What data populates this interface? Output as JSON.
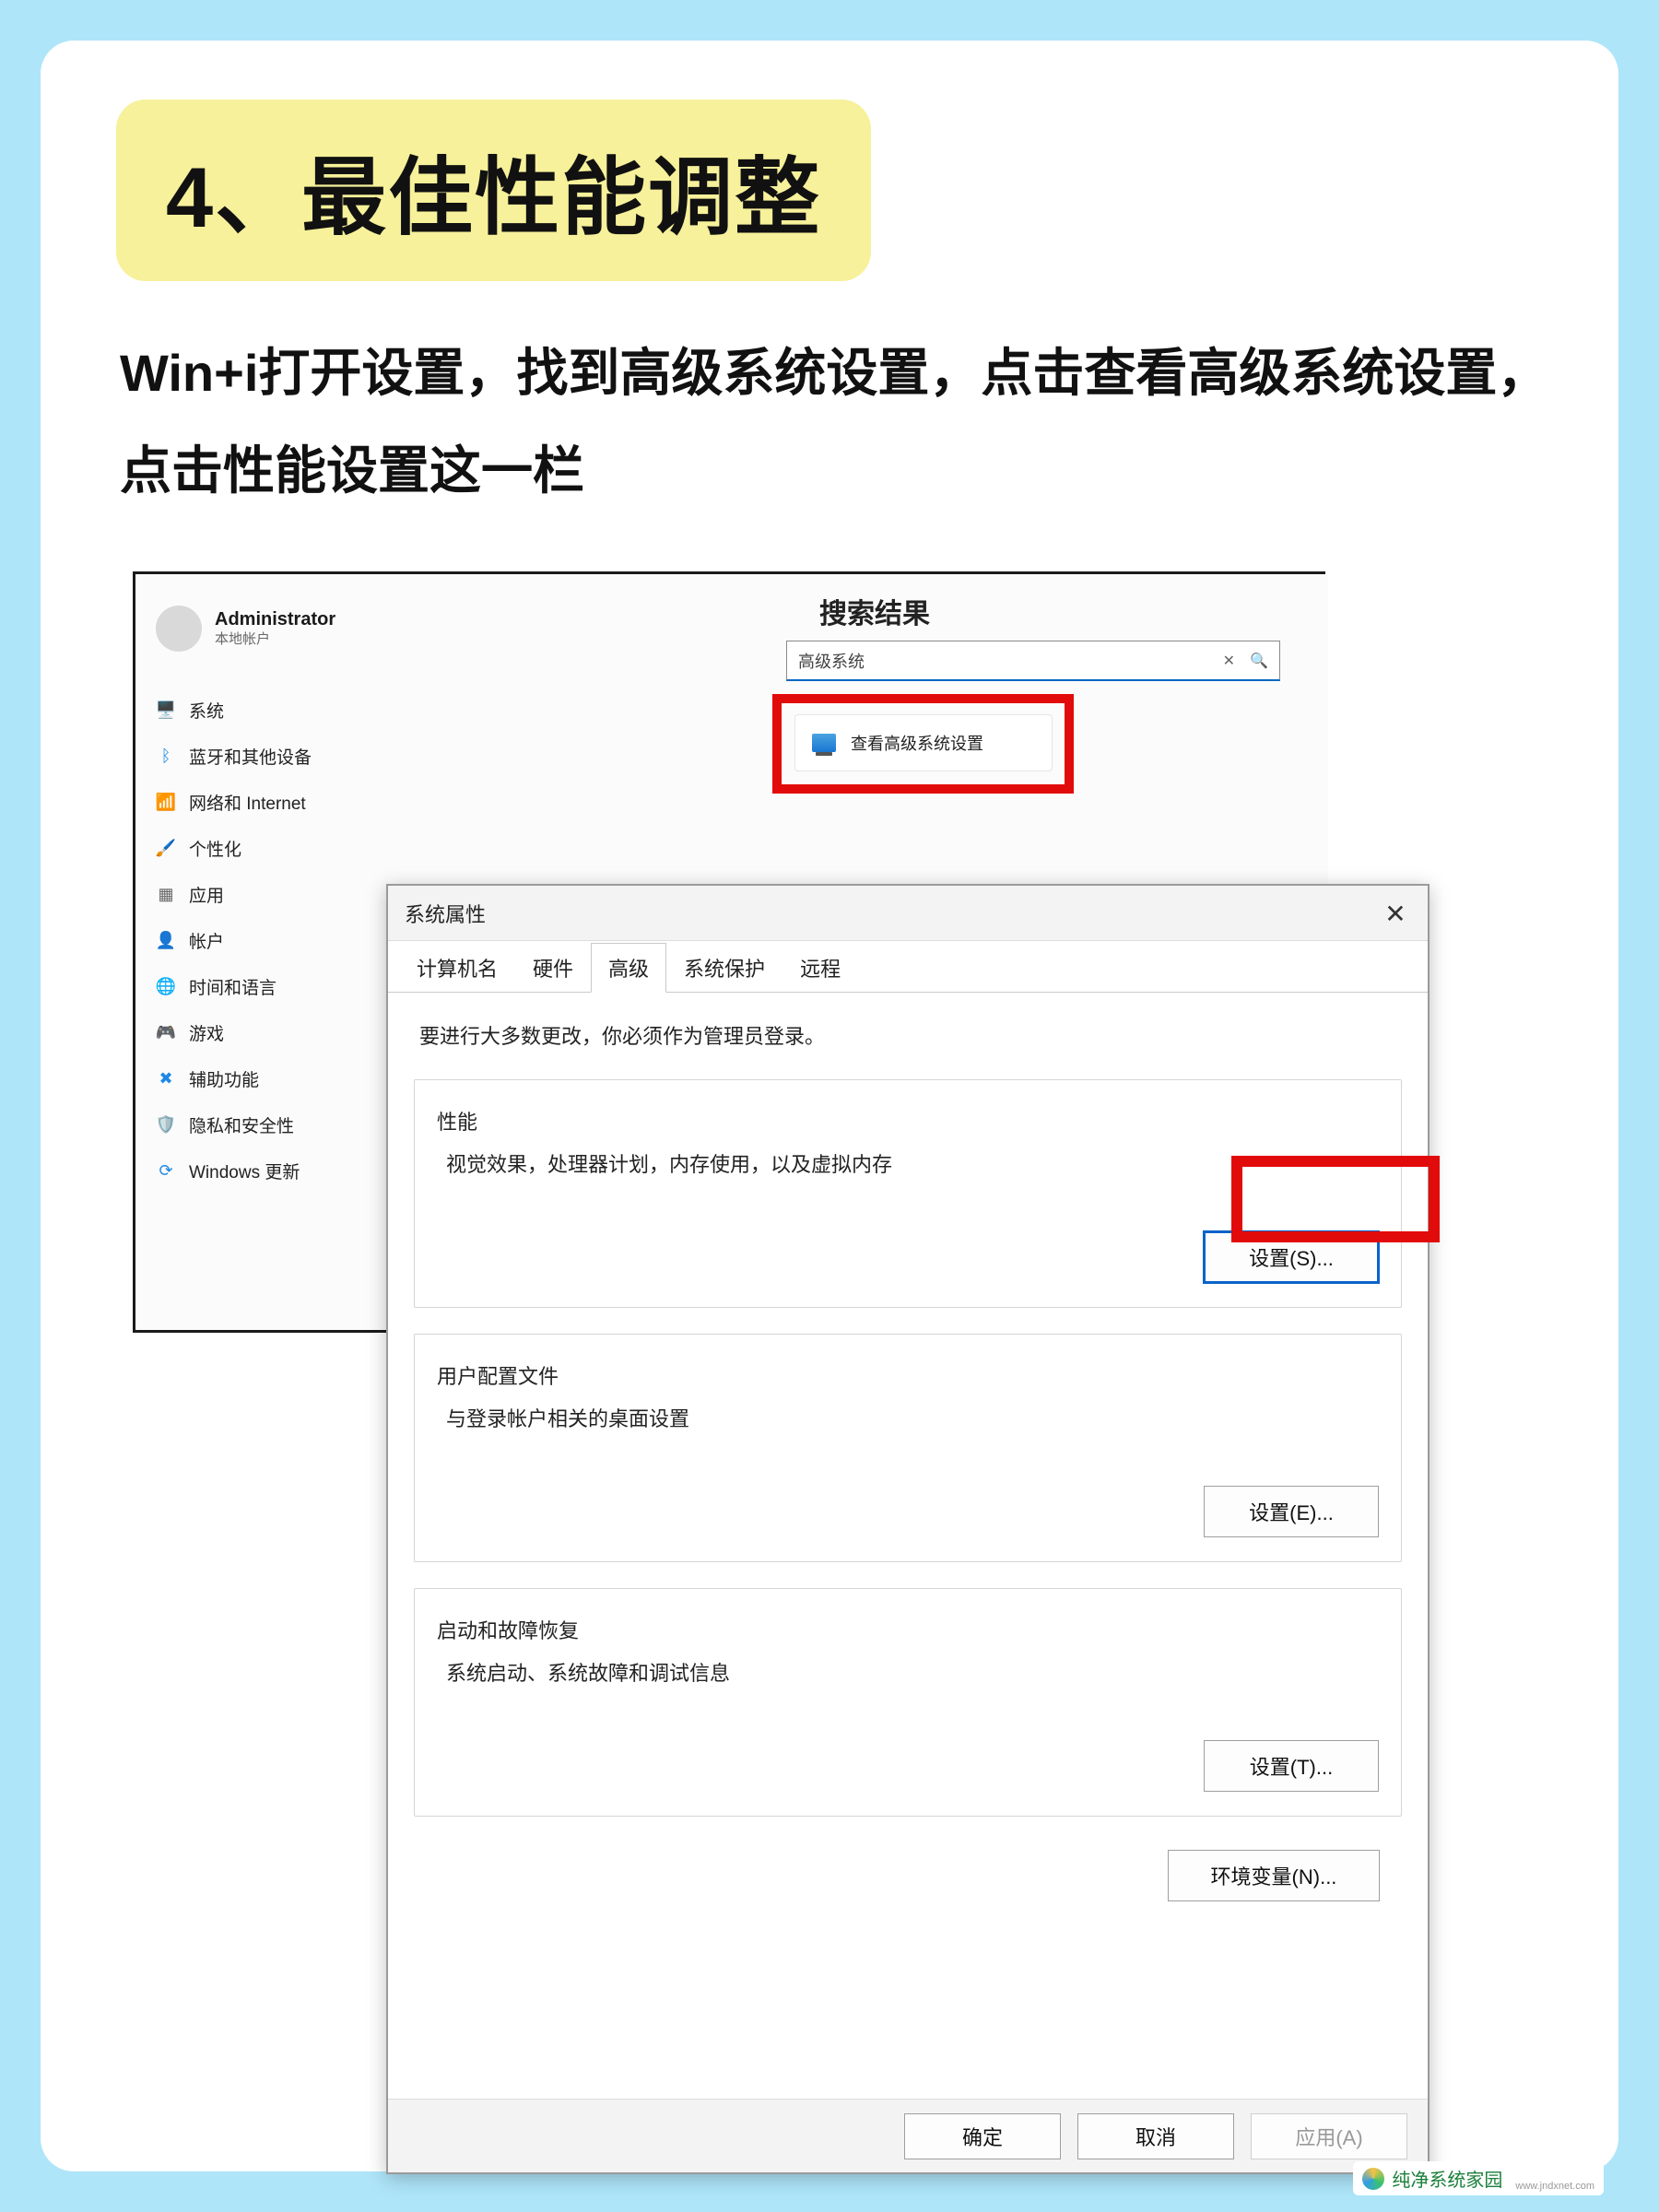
{
  "banner": {
    "title": "4、最佳性能调整"
  },
  "instructions": "Win+i打开设置，找到高级系统设置，点击查看高级系统设置，点击性能设置这一栏",
  "settings": {
    "user": {
      "name": "Administrator",
      "subtitle": "本地帐户"
    },
    "nav": [
      {
        "icon": "🖥️",
        "label": "系统",
        "color": "#1e88e5"
      },
      {
        "icon": "ᛒ",
        "label": "蓝牙和其他设备",
        "color": "#1e88e5"
      },
      {
        "icon": "📶",
        "label": "网络和 Internet",
        "color": "#1e88e5"
      },
      {
        "icon": "🖌️",
        "label": "个性化",
        "color": "#c09030"
      },
      {
        "icon": "▦",
        "label": "应用",
        "color": "#666"
      },
      {
        "icon": "👤",
        "label": "帐户",
        "color": "#2e9e5b"
      },
      {
        "icon": "🌐",
        "label": "时间和语言",
        "color": "#3a6fb0"
      },
      {
        "icon": "🎮",
        "label": "游戏",
        "color": "#888"
      },
      {
        "icon": "✖",
        "label": "辅助功能",
        "color": "#1e88e5"
      },
      {
        "icon": "🛡️",
        "label": "隐私和安全性",
        "color": "#888"
      },
      {
        "icon": "⟳",
        "label": "Windows 更新",
        "color": "#1e88e5"
      }
    ],
    "main": {
      "heading": "搜索结果",
      "search_value": "高级系统",
      "result_label": "查看高级系统设置"
    }
  },
  "sysprop": {
    "title": "系统属性",
    "tabs": [
      "计算机名",
      "硬件",
      "高级",
      "系统保护",
      "远程"
    ],
    "active_tab_index": 2,
    "note": "要进行大多数更改，你必须作为管理员登录。",
    "groups": {
      "performance": {
        "title": "性能",
        "desc": "视觉效果，处理器计划，内存使用，以及虚拟内存",
        "button": "设置(S)..."
      },
      "profiles": {
        "title": "用户配置文件",
        "desc": "与登录帐户相关的桌面设置",
        "button": "设置(E)..."
      },
      "startup": {
        "title": "启动和故障恢复",
        "desc": "系统启动、系统故障和调试信息",
        "button": "设置(T)..."
      }
    },
    "env_button": "环境变量(N)...",
    "footer": {
      "ok": "确定",
      "cancel": "取消",
      "apply": "应用(A)"
    }
  },
  "watermark": {
    "text": "纯净系统家园",
    "sub": "www.jndxnet.com"
  }
}
